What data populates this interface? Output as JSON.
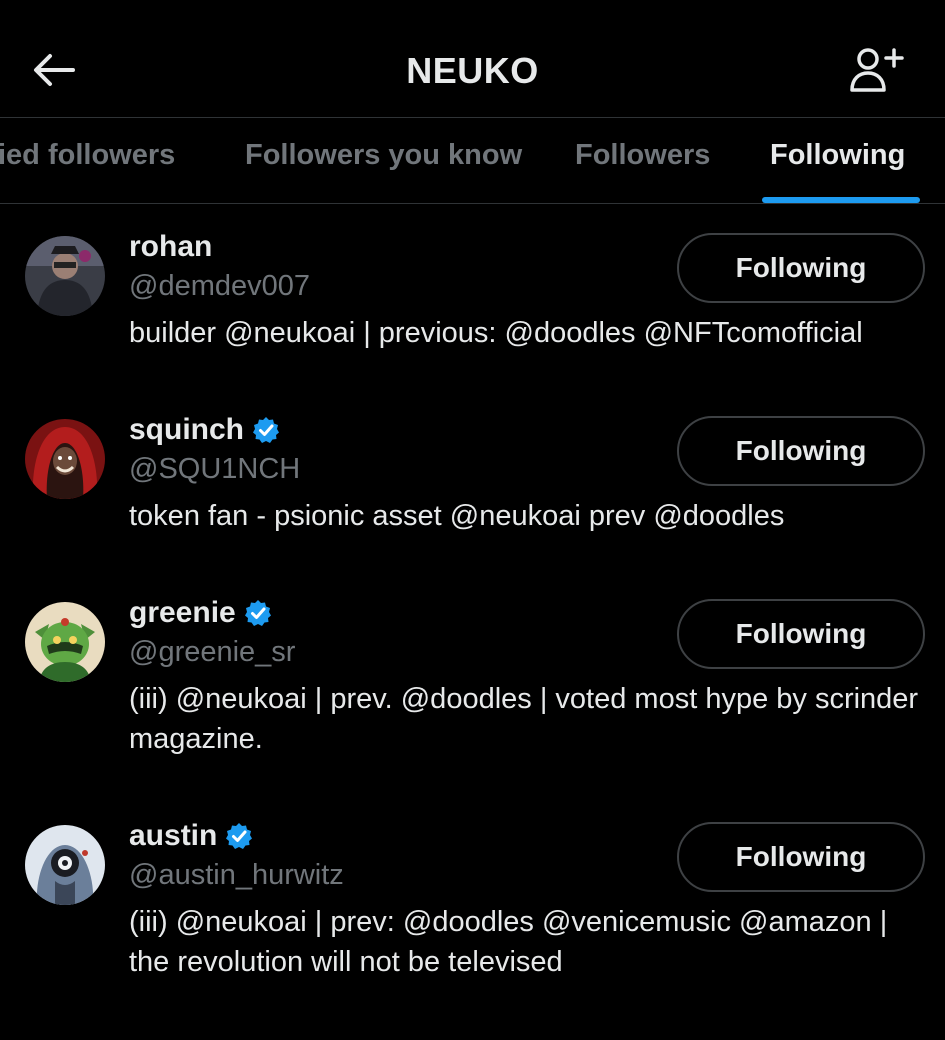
{
  "header": {
    "title": "NEUKO",
    "back_icon": "arrow-left-icon",
    "add_user_icon": "person-add-icon"
  },
  "tabs": [
    {
      "label": "ied followers"
    },
    {
      "label": "Followers you know"
    },
    {
      "label": "Followers"
    },
    {
      "label": "Following",
      "active": true
    }
  ],
  "colors": {
    "background": "#000000",
    "accent": "#1d9bf0",
    "text_primary": "#e7e9ea",
    "text_secondary": "#71767b"
  },
  "users": [
    {
      "name": "rohan",
      "handle": "@demdev007",
      "verified": false,
      "bio": "builder @neukoai | previous: @doodles @NFTcomofficial",
      "button": "Following"
    },
    {
      "name": "squinch",
      "handle": "@SQU1NCH",
      "verified": true,
      "bio": "token fan - psionic asset @neukoai prev @doodles",
      "button": "Following"
    },
    {
      "name": "greenie",
      "handle": "@greenie_sr",
      "verified": true,
      "bio": "(iii) @neukoai | prev. @doodles | voted most hype by scrinder magazine.",
      "button": "Following"
    },
    {
      "name": "austin",
      "handle": "@austin_hurwitz",
      "verified": true,
      "bio": "(iii) @neukoai | prev: @doodles @venicemusic @amazon | the revolution will not be televised",
      "button": "Following"
    }
  ]
}
